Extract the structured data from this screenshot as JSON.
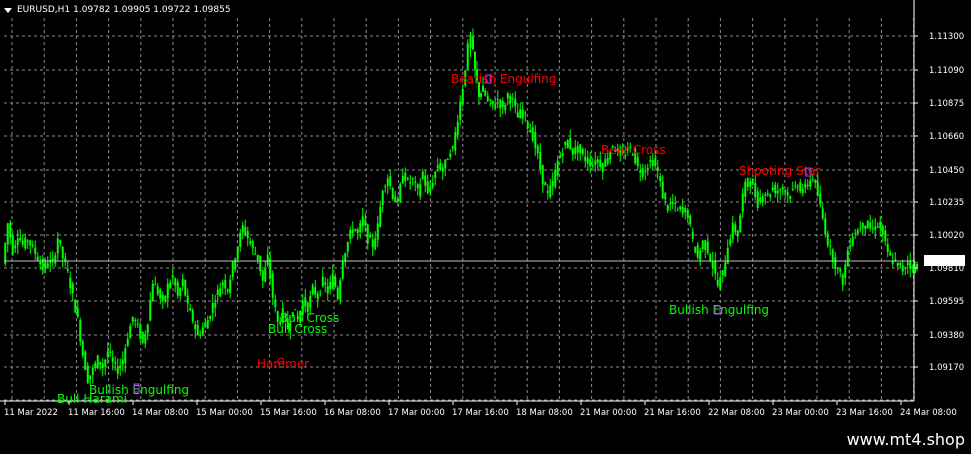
{
  "header": {
    "symbol_timeframe": "EURUSD,H1",
    "ohlc": "1.09782 1.09905 1.09722 1.09855"
  },
  "watermark": "www.mt4.shop",
  "current_price": "1.09855",
  "colors": {
    "background": "#000000",
    "grid": "#8c8c8c",
    "candle": "#00ff00",
    "bearish_label": "#ff0000",
    "bullish_label": "#00ff00",
    "current_price_line": "#c0c0c0"
  },
  "chart_data": {
    "type": "candlestick",
    "symbol": "EURUSD",
    "timeframe": "H1",
    "ylim": [
      1.0898,
      1.1144
    ],
    "y_ticks": [
      "1.11300",
      "1.11090",
      "1.10875",
      "1.10660",
      "1.10450",
      "1.10235",
      "1.10020",
      "1.09810",
      "1.09595",
      "1.09380",
      "1.09170"
    ],
    "x_ticks": [
      "11 Mar 2022",
      "11 Mar 16:00",
      "14 Mar 08:00",
      "15 Mar 00:00",
      "15 Mar 16:00",
      "16 Mar 08:00",
      "17 Mar 00:00",
      "17 Mar 16:00",
      "18 Mar 08:00",
      "21 Mar 00:00",
      "21 Mar 16:00",
      "22 Mar 08:00",
      "23 Mar 00:00",
      "23 Mar 16:00",
      "24 Mar 08:00"
    ],
    "grid": true,
    "price_path": [
      [
        0,
        1.0986
      ],
      [
        5,
        1.1012
      ],
      [
        10,
        1.0995
      ],
      [
        15,
        1.1005
      ],
      [
        20,
        1.0998
      ],
      [
        25,
        1.1002
      ],
      [
        30,
        1.0996
      ],
      [
        35,
        1.099
      ],
      [
        40,
        1.0983
      ],
      [
        45,
        1.0988
      ],
      [
        50,
        1.0986
      ],
      [
        55,
        1.1003
      ],
      [
        60,
        1.099
      ],
      [
        65,
        1.098
      ],
      [
        70,
        1.0965
      ],
      [
        75,
        1.095
      ],
      [
        80,
        1.0928
      ],
      [
        85,
        1.0912
      ],
      [
        90,
        1.0918
      ],
      [
        95,
        1.0925
      ],
      [
        100,
        1.092
      ],
      [
        105,
        1.093
      ],
      [
        110,
        1.0922
      ],
      [
        115,
        1.0918
      ],
      [
        120,
        1.0925
      ],
      [
        125,
        1.094
      ],
      [
        130,
        1.0952
      ],
      [
        135,
        1.0945
      ],
      [
        140,
        1.0935
      ],
      [
        145,
        1.095
      ],
      [
        150,
        1.0975
      ],
      [
        155,
        1.0968
      ],
      [
        160,
        1.096
      ],
      [
        165,
        1.0972
      ],
      [
        170,
        1.0978
      ],
      [
        175,
        1.0965
      ],
      [
        180,
        1.0975
      ],
      [
        185,
        1.0958
      ],
      [
        190,
        1.095
      ],
      [
        195,
        1.094
      ],
      [
        200,
        1.0945
      ],
      [
        205,
        1.095
      ],
      [
        210,
        1.096
      ],
      [
        215,
        1.0968
      ],
      [
        220,
        1.0975
      ],
      [
        225,
        1.097
      ],
      [
        230,
        1.0985
      ],
      [
        235,
        1.0998
      ],
      [
        240,
        1.101
      ],
      [
        245,
        1.1003
      ],
      [
        250,
        1.0995
      ],
      [
        255,
        1.099
      ],
      [
        260,
        1.0975
      ],
      [
        265,
        1.099
      ],
      [
        270,
        1.0965
      ],
      [
        275,
        1.0948
      ],
      [
        280,
        1.0955
      ],
      [
        285,
        1.0945
      ],
      [
        290,
        1.0958
      ],
      [
        295,
        1.095
      ],
      [
        300,
        1.0962
      ],
      [
        305,
        1.0958
      ],
      [
        310,
        1.097
      ],
      [
        315,
        1.0965
      ],
      [
        320,
        1.0975
      ],
      [
        325,
        1.0968
      ],
      [
        330,
        1.0978
      ],
      [
        335,
        1.0965
      ],
      [
        340,
        1.099
      ],
      [
        345,
        1.1
      ],
      [
        350,
        1.101
      ],
      [
        355,
        1.1005
      ],
      [
        360,
        1.1015
      ],
      [
        365,
        1.1002
      ],
      [
        370,
        1.0998
      ],
      [
        375,
        1.101
      ],
      [
        380,
        1.1035
      ],
      [
        385,
        1.1042
      ],
      [
        390,
        1.103
      ],
      [
        395,
        1.1025
      ],
      [
        400,
        1.1045
      ],
      [
        405,
        1.1038
      ],
      [
        410,
        1.104
      ],
      [
        415,
        1.1032
      ],
      [
        420,
        1.1045
      ],
      [
        425,
        1.103
      ],
      [
        430,
        1.104
      ],
      [
        435,
        1.105
      ],
      [
        440,
        1.1046
      ],
      [
        445,
        1.1055
      ],
      [
        450,
        1.106
      ],
      [
        455,
        1.108
      ],
      [
        460,
        1.11
      ],
      [
        465,
        1.1125
      ],
      [
        468,
        1.1132
      ],
      [
        472,
        1.111
      ],
      [
        476,
        1.1095
      ],
      [
        480,
        1.1098
      ],
      [
        485,
        1.109
      ],
      [
        490,
        1.1088
      ],
      [
        495,
        1.1092
      ],
      [
        500,
        1.1085
      ],
      [
        505,
        1.1095
      ],
      [
        510,
        1.109
      ],
      [
        515,
        1.108
      ],
      [
        520,
        1.1085
      ],
      [
        525,
        1.1075
      ],
      [
        530,
        1.1068
      ],
      [
        535,
        1.1055
      ],
      [
        540,
        1.104
      ],
      [
        545,
        1.103
      ],
      [
        550,
        1.1038
      ],
      [
        555,
        1.1052
      ],
      [
        560,
        1.106
      ],
      [
        565,
        1.1065
      ],
      [
        570,
        1.1058
      ],
      [
        575,
        1.106
      ],
      [
        580,
        1.1055
      ],
      [
        585,
        1.1052
      ],
      [
        590,
        1.105
      ],
      [
        595,
        1.1053
      ],
      [
        600,
        1.1048
      ],
      [
        605,
        1.1056
      ],
      [
        610,
        1.1062
      ],
      [
        615,
        1.1058
      ],
      [
        620,
        1.1055
      ],
      [
        625,
        1.106
      ],
      [
        630,
        1.1058
      ],
      [
        635,
        1.1048
      ],
      [
        640,
        1.1045
      ],
      [
        645,
        1.105
      ],
      [
        650,
        1.1052
      ],
      [
        655,
        1.1045
      ],
      [
        660,
        1.103
      ],
      [
        665,
        1.1022
      ],
      [
        670,
        1.1025
      ],
      [
        675,
        1.102
      ],
      [
        680,
        1.1022
      ],
      [
        685,
        1.1018
      ],
      [
        690,
        1.1
      ],
      [
        695,
        1.099
      ],
      [
        700,
        1.1
      ],
      [
        705,
        1.0995
      ],
      [
        710,
        1.0985
      ],
      [
        715,
        1.0972
      ],
      [
        720,
        1.098
      ],
      [
        725,
        1.0998
      ],
      [
        730,
        1.101
      ],
      [
        735,
        1.1005
      ],
      [
        740,
        1.103
      ],
      [
        745,
        1.1042
      ],
      [
        750,
        1.1035
      ],
      [
        755,
        1.1025
      ],
      [
        760,
        1.1032
      ],
      [
        765,
        1.103
      ],
      [
        770,
        1.1035
      ],
      [
        775,
        1.1032
      ],
      [
        780,
        1.1036
      ],
      [
        785,
        1.103
      ],
      [
        790,
        1.1033
      ],
      [
        795,
        1.1038
      ],
      [
        800,
        1.1032
      ],
      [
        805,
        1.1038
      ],
      [
        810,
        1.1042
      ],
      [
        815,
        1.103
      ],
      [
        820,
        1.1015
      ],
      [
        825,
        1.1
      ],
      [
        830,
        1.099
      ],
      [
        835,
        1.0982
      ],
      [
        840,
        1.0975
      ],
      [
        845,
        1.0995
      ],
      [
        850,
        1.1005
      ],
      [
        855,
        1.1008
      ],
      [
        860,
        1.1012
      ],
      [
        865,
        1.101
      ],
      [
        870,
        1.1008
      ],
      [
        875,
        1.1012
      ],
      [
        880,
        1.1005
      ],
      [
        885,
        1.0992
      ],
      [
        890,
        1.0988
      ],
      [
        895,
        1.0985
      ],
      [
        900,
        1.0982
      ],
      [
        905,
        1.0988
      ],
      [
        910,
        1.0983
      ],
      [
        914,
        1.0985
      ]
    ],
    "annotations": [
      {
        "text": "Bearish Engulfing",
        "type": "bearish"
      },
      {
        "text": "Bear Cross",
        "type": "bearish"
      },
      {
        "text": "Shooting Star",
        "type": "bearish"
      },
      {
        "text": "Bull Cross",
        "type": "bullish"
      },
      {
        "text": "Bull Cross",
        "type": "bullish"
      },
      {
        "text": "Hammer",
        "type": "bearish"
      },
      {
        "text": "Bullish Engulfing",
        "type": "bullish"
      },
      {
        "text": "Bull Harami",
        "type": "bullish"
      },
      {
        "text": "Bullish Engulfing",
        "type": "bullish"
      }
    ]
  }
}
